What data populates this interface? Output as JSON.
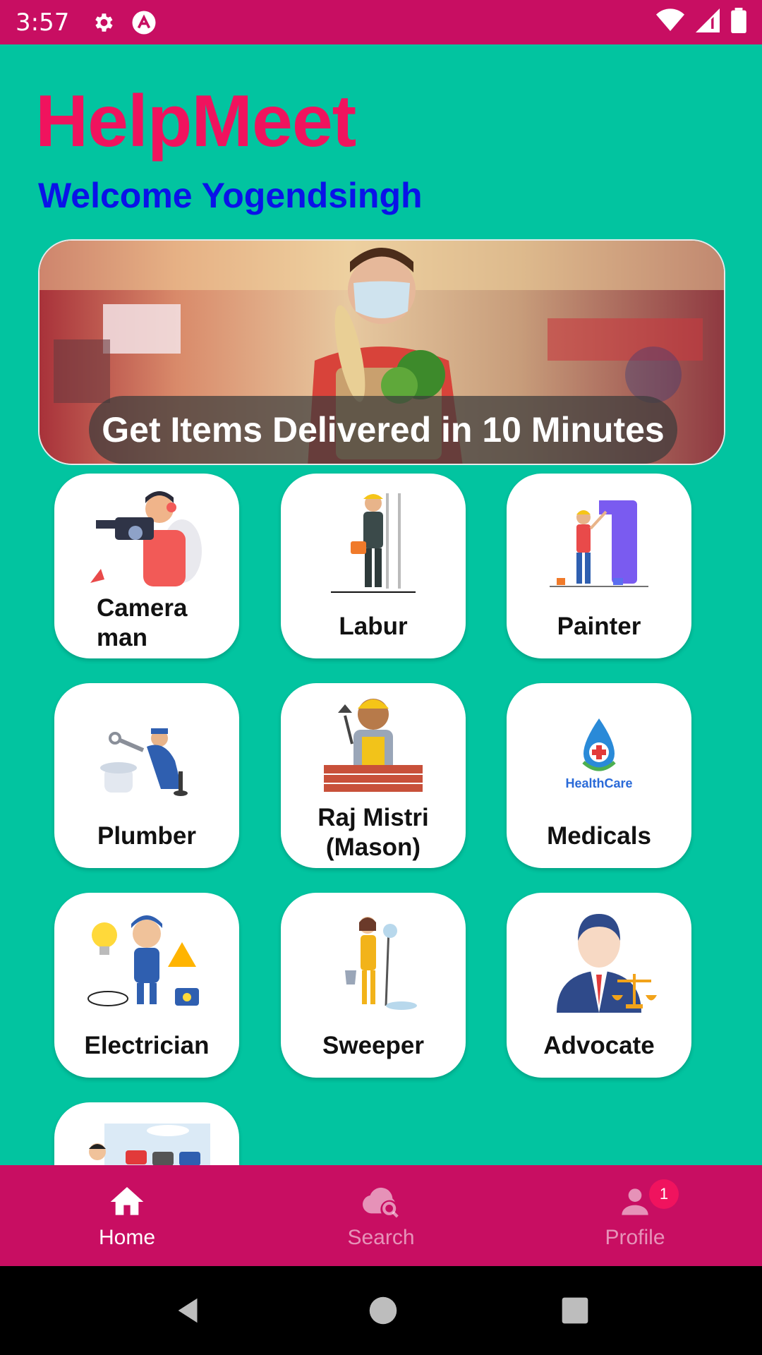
{
  "status_bar": {
    "time": "3:57"
  },
  "header": {
    "title": "HelpMeet",
    "welcome": "Welcome Yogendsingh"
  },
  "banner": {
    "caption": "Get Items Delivered in 10 Minutes"
  },
  "services": [
    {
      "label": "Camera man"
    },
    {
      "label": "Labur"
    },
    {
      "label": "Painter"
    },
    {
      "label": "Plumber"
    },
    {
      "label": "Raj Mistri (Mason)"
    },
    {
      "label": "Medicals"
    },
    {
      "label": "Electrician"
    },
    {
      "label": "Sweeper"
    },
    {
      "label": "Advocate"
    }
  ],
  "bottom_nav": {
    "items": [
      {
        "label": "Home",
        "icon": "home-icon"
      },
      {
        "label": "Search",
        "icon": "cloud-search-icon"
      },
      {
        "label": "Profile",
        "icon": "person-icon"
      }
    ],
    "profile_badge": "1"
  },
  "colors": {
    "accent": "#c80e62",
    "background": "#02c4a0",
    "title": "#f0135e",
    "welcome": "#0a13e8"
  }
}
